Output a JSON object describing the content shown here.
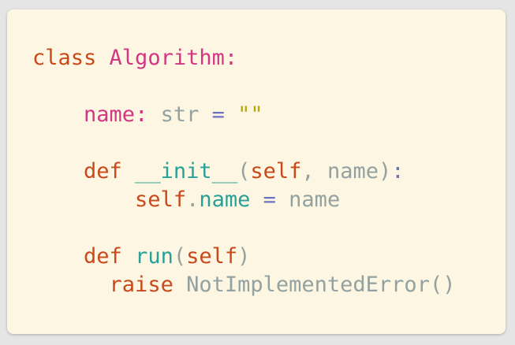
{
  "colors": {
    "background": "#fdf6e3",
    "page": "#e5e5e5",
    "keyword": "#c8491a",
    "class_name": "#d33682",
    "attribute": "#d33682",
    "function": "#2aa198",
    "builtin": "#93a1a1",
    "string": "#b5a800",
    "operator": "#6c71c4",
    "punctuation": "#93a1a1",
    "identifier": "#93a1a1"
  },
  "code": {
    "lines": [
      {
        "tokens": [
          {
            "text": "class",
            "kind": "keyword"
          },
          {
            "text": " ",
            "kind": "ws"
          },
          {
            "text": "Algorithm",
            "kind": "class_name"
          },
          {
            "text": ":",
            "kind": "class_name"
          }
        ]
      },
      {
        "tokens": [
          {
            "text": "    ",
            "kind": "ws"
          },
          {
            "text": "name",
            "kind": "attribute"
          },
          {
            "text": ":",
            "kind": "attribute"
          },
          {
            "text": " ",
            "kind": "ws"
          },
          {
            "text": "str",
            "kind": "builtin"
          },
          {
            "text": " ",
            "kind": "ws"
          },
          {
            "text": "=",
            "kind": "operator"
          },
          {
            "text": " ",
            "kind": "ws"
          },
          {
            "text": "\"\"",
            "kind": "string"
          }
        ]
      },
      {
        "tokens": [
          {
            "text": "    ",
            "kind": "ws"
          },
          {
            "text": "def",
            "kind": "keyword"
          },
          {
            "text": " ",
            "kind": "ws"
          },
          {
            "text": "__init__",
            "kind": "function"
          },
          {
            "text": "(",
            "kind": "punctuation"
          },
          {
            "text": "self",
            "kind": "keyword"
          },
          {
            "text": ", ",
            "kind": "punctuation"
          },
          {
            "text": "name",
            "kind": "identifier"
          },
          {
            "text": ")",
            "kind": "punctuation"
          },
          {
            "text": ":",
            "kind": "operator"
          }
        ]
      },
      {
        "tokens": [
          {
            "text": "        ",
            "kind": "ws"
          },
          {
            "text": "self",
            "kind": "keyword"
          },
          {
            "text": ".",
            "kind": "punctuation"
          },
          {
            "text": "name",
            "kind": "function"
          },
          {
            "text": " ",
            "kind": "ws"
          },
          {
            "text": "=",
            "kind": "operator"
          },
          {
            "text": " ",
            "kind": "ws"
          },
          {
            "text": "name",
            "kind": "identifier"
          }
        ]
      },
      {
        "tokens": [
          {
            "text": "    ",
            "kind": "ws"
          },
          {
            "text": "def",
            "kind": "keyword"
          },
          {
            "text": " ",
            "kind": "ws"
          },
          {
            "text": "run",
            "kind": "function"
          },
          {
            "text": "(",
            "kind": "punctuation"
          },
          {
            "text": "self",
            "kind": "keyword"
          },
          {
            "text": ")",
            "kind": "punctuation"
          }
        ]
      },
      {
        "tokens": [
          {
            "text": "      ",
            "kind": "ws"
          },
          {
            "text": "raise",
            "kind": "keyword"
          },
          {
            "text": " ",
            "kind": "ws"
          },
          {
            "text": "NotImplementedError",
            "kind": "builtin"
          },
          {
            "text": "()",
            "kind": "punctuation"
          }
        ]
      }
    ]
  }
}
